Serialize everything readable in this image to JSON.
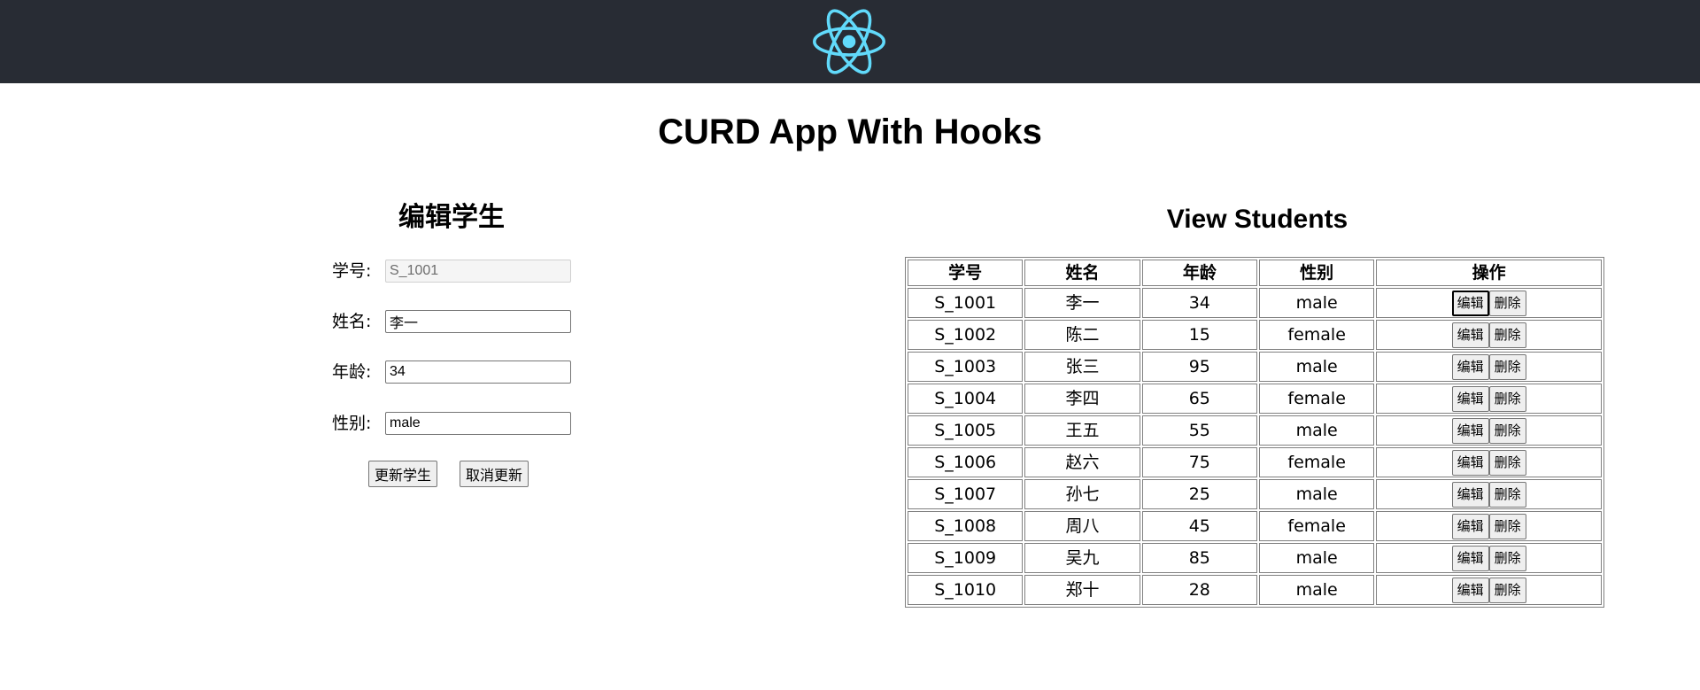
{
  "header": {
    "logo_icon": "react-logo-icon",
    "bg_color": "#282c34",
    "logo_color": "#61dafb"
  },
  "page": {
    "title": "CURD App With Hooks"
  },
  "edit_form": {
    "heading": "编辑学生",
    "fields": [
      {
        "label": "学号:",
        "value": "S_1001",
        "disabled": true
      },
      {
        "label": "姓名:",
        "value": "李一"
      },
      {
        "label": "年龄:",
        "value": "34"
      },
      {
        "label": "性别:",
        "value": "male"
      }
    ],
    "update_label": "更新学生",
    "cancel_label": "取消更新"
  },
  "view": {
    "heading": "View Students",
    "columns": [
      "学号",
      "姓名",
      "年龄",
      "性别",
      "操作"
    ],
    "edit_label": "编辑",
    "delete_label": "删除",
    "rows": [
      {
        "id": "S_1001",
        "name": "李一",
        "age": "34",
        "gender": "male"
      },
      {
        "id": "S_1002",
        "name": "陈二",
        "age": "15",
        "gender": "female"
      },
      {
        "id": "S_1003",
        "name": "张三",
        "age": "95",
        "gender": "male"
      },
      {
        "id": "S_1004",
        "name": "李四",
        "age": "65",
        "gender": "female"
      },
      {
        "id": "S_1005",
        "name": "王五",
        "age": "55",
        "gender": "male"
      },
      {
        "id": "S_1006",
        "name": "赵六",
        "age": "75",
        "gender": "female"
      },
      {
        "id": "S_1007",
        "name": "孙七",
        "age": "25",
        "gender": "male"
      },
      {
        "id": "S_1008",
        "name": "周八",
        "age": "45",
        "gender": "female"
      },
      {
        "id": "S_1009",
        "name": "吴九",
        "age": "85",
        "gender": "male"
      },
      {
        "id": "S_1010",
        "name": "郑十",
        "age": "28",
        "gender": "male"
      }
    ]
  }
}
